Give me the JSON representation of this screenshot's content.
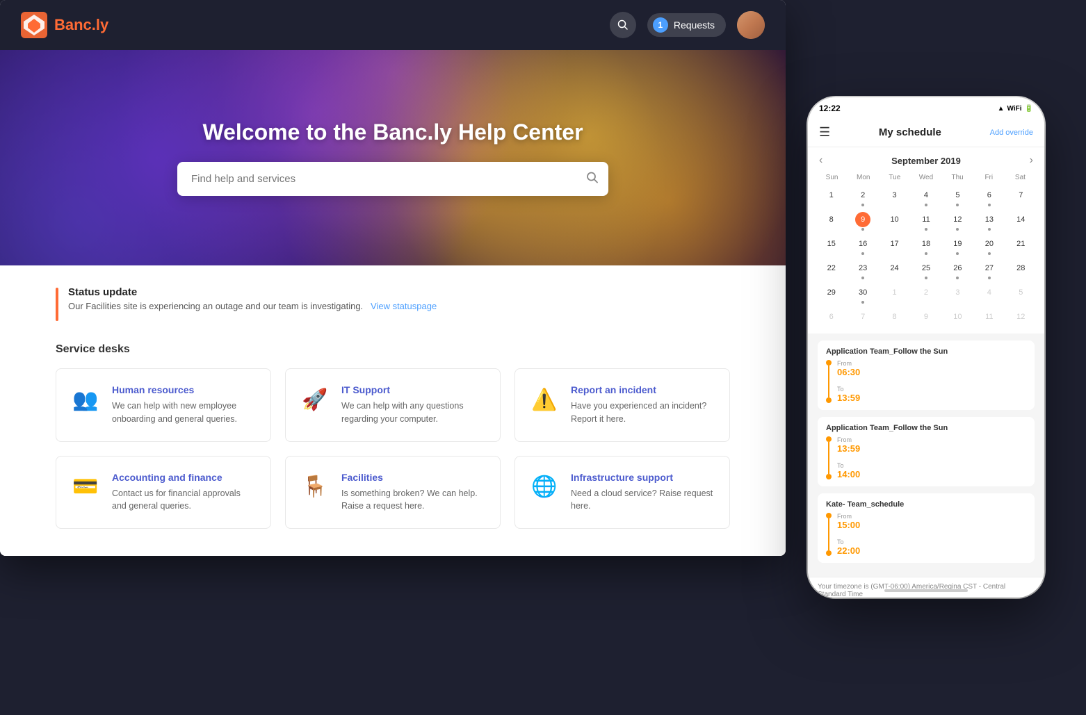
{
  "nav": {
    "logo_text": "Banc.ly",
    "requests_label": "Requests",
    "requests_count": "1"
  },
  "hero": {
    "title": "Welcome to the Banc.ly Help Center",
    "search_placeholder": "Find help and services"
  },
  "status": {
    "title": "Status update",
    "description": "Our Facilities site is experiencing an outage and our team is investigating.",
    "link_text": "View statuspage"
  },
  "service_desks": {
    "section_title": "Service desks",
    "cards": [
      {
        "name": "Human resources",
        "description": "We can help with new employee onboarding and general queries.",
        "icon": "👥",
        "icon_color": "#2196F3"
      },
      {
        "name": "IT Support",
        "description": "We can help with any questions regarding your computer.",
        "icon": "🚀",
        "icon_color": "#4CAF50"
      },
      {
        "name": "Report an incident",
        "description": "Have you experienced an incident? Report it here.",
        "icon": "⚠️",
        "icon_color": "#FF9800"
      },
      {
        "name": "Accounting and finance",
        "description": "Contact us for financial approvals and general queries.",
        "icon": "💳",
        "icon_color": "#2196F3"
      },
      {
        "name": "Facilities",
        "description": "Is something broken? We can help. Raise a request here.",
        "icon": "🪑",
        "icon_color": "#673AB7"
      },
      {
        "name": "Infrastructure support",
        "description": "Need a cloud service? Raise request here.",
        "icon": "🌐",
        "icon_color": "#2196F3"
      }
    ]
  },
  "phone": {
    "status_time": "12:22",
    "header_title": "My schedule",
    "add_override": "Add override",
    "calendar_month": "September 2019",
    "day_names": [
      "Sun",
      "Mon",
      "Tue",
      "Wed",
      "Thu",
      "Fri",
      "Sat"
    ],
    "calendar_rows": [
      [
        {
          "num": "1",
          "dot": false,
          "other": false,
          "today": false
        },
        {
          "num": "2",
          "dot": true,
          "other": false,
          "today": false
        },
        {
          "num": "3",
          "dot": false,
          "other": false,
          "today": false
        },
        {
          "num": "4",
          "dot": true,
          "other": false,
          "today": false
        },
        {
          "num": "5",
          "dot": true,
          "other": false,
          "today": false
        },
        {
          "num": "6",
          "dot": true,
          "other": false,
          "today": false
        },
        {
          "num": "7",
          "dot": false,
          "other": false,
          "today": false
        }
      ],
      [
        {
          "num": "8",
          "dot": false,
          "other": false,
          "today": false
        },
        {
          "num": "9",
          "dot": true,
          "other": false,
          "today": true
        },
        {
          "num": "10",
          "dot": false,
          "other": false,
          "today": false
        },
        {
          "num": "11",
          "dot": true,
          "other": false,
          "today": false
        },
        {
          "num": "12",
          "dot": true,
          "other": false,
          "today": false
        },
        {
          "num": "13",
          "dot": true,
          "other": false,
          "today": false
        },
        {
          "num": "14",
          "dot": false,
          "other": false,
          "today": false
        }
      ],
      [
        {
          "num": "15",
          "dot": false,
          "other": false,
          "today": false
        },
        {
          "num": "16",
          "dot": true,
          "other": false,
          "today": false
        },
        {
          "num": "17",
          "dot": false,
          "other": false,
          "today": false
        },
        {
          "num": "18",
          "dot": true,
          "other": false,
          "today": false
        },
        {
          "num": "19",
          "dot": true,
          "other": false,
          "today": false
        },
        {
          "num": "20",
          "dot": true,
          "other": false,
          "today": false
        },
        {
          "num": "21",
          "dot": false,
          "other": false,
          "today": false
        }
      ],
      [
        {
          "num": "22",
          "dot": false,
          "other": false,
          "today": false
        },
        {
          "num": "23",
          "dot": true,
          "other": false,
          "today": false
        },
        {
          "num": "24",
          "dot": false,
          "other": false,
          "today": false
        },
        {
          "num": "25",
          "dot": true,
          "other": false,
          "today": false
        },
        {
          "num": "26",
          "dot": true,
          "other": false,
          "today": false
        },
        {
          "num": "27",
          "dot": true,
          "other": false,
          "today": false
        },
        {
          "num": "28",
          "dot": false,
          "other": false,
          "today": false
        }
      ],
      [
        {
          "num": "29",
          "dot": false,
          "other": false,
          "today": false
        },
        {
          "num": "30",
          "dot": true,
          "other": false,
          "today": false
        },
        {
          "num": "1",
          "dot": false,
          "other": true,
          "today": false
        },
        {
          "num": "2",
          "dot": false,
          "other": true,
          "today": false
        },
        {
          "num": "3",
          "dot": false,
          "other": true,
          "today": false
        },
        {
          "num": "4",
          "dot": false,
          "other": true,
          "today": false
        },
        {
          "num": "5",
          "dot": false,
          "other": true,
          "today": false
        }
      ],
      [
        {
          "num": "6",
          "dot": false,
          "other": true,
          "today": false
        },
        {
          "num": "7",
          "dot": false,
          "other": true,
          "today": false
        },
        {
          "num": "8",
          "dot": false,
          "other": true,
          "today": false
        },
        {
          "num": "9",
          "dot": false,
          "other": true,
          "today": false
        },
        {
          "num": "10",
          "dot": false,
          "other": true,
          "today": false
        },
        {
          "num": "11",
          "dot": false,
          "other": true,
          "today": false
        },
        {
          "num": "12",
          "dot": false,
          "other": true,
          "today": false
        }
      ]
    ],
    "schedules": [
      {
        "title": "Application Team_Follow the Sun",
        "from_label": "From",
        "from_time": "06:30",
        "to_label": "To",
        "to_time": "13:59"
      },
      {
        "title": "Application Team_Follow the Sun",
        "from_label": "From",
        "from_time": "13:59",
        "to_label": "To",
        "to_time": "14:00"
      },
      {
        "title": "Kate- Team_schedule",
        "from_label": "From",
        "from_time": "15:00",
        "to_label": "To",
        "to_time": "22:00"
      }
    ],
    "timezone": "Your timezone is (GMT-06:00) America/Regina CST - Central Standard Time"
  }
}
